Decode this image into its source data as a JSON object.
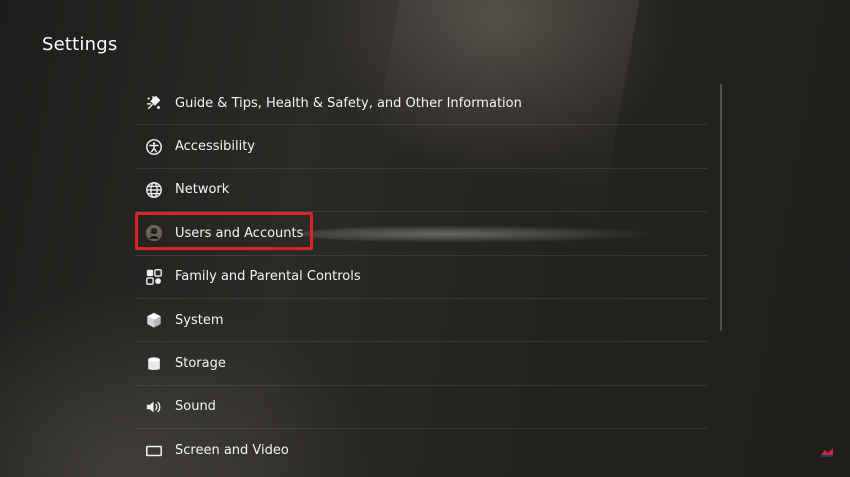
{
  "page": {
    "title": "Settings"
  },
  "menu": {
    "items": [
      {
        "label": "Guide & Tips, Health & Safety, and Other Information",
        "icon": "guide-tips-icon"
      },
      {
        "label": "Accessibility",
        "icon": "accessibility-icon"
      },
      {
        "label": "Network",
        "icon": "globe-icon"
      },
      {
        "label": "Users and Accounts",
        "icon": "user-avatar-icon",
        "highlighted": true
      },
      {
        "label": "Family and Parental Controls",
        "icon": "family-controls-icon"
      },
      {
        "label": "System",
        "icon": "cube-icon"
      },
      {
        "label": "Storage",
        "icon": "database-icon"
      },
      {
        "label": "Sound",
        "icon": "speaker-icon"
      },
      {
        "label": "Screen and Video",
        "icon": "screen-icon"
      }
    ]
  },
  "colors": {
    "highlight": "#d8222e",
    "text": "#f4f4f4",
    "background": "#26241f"
  }
}
